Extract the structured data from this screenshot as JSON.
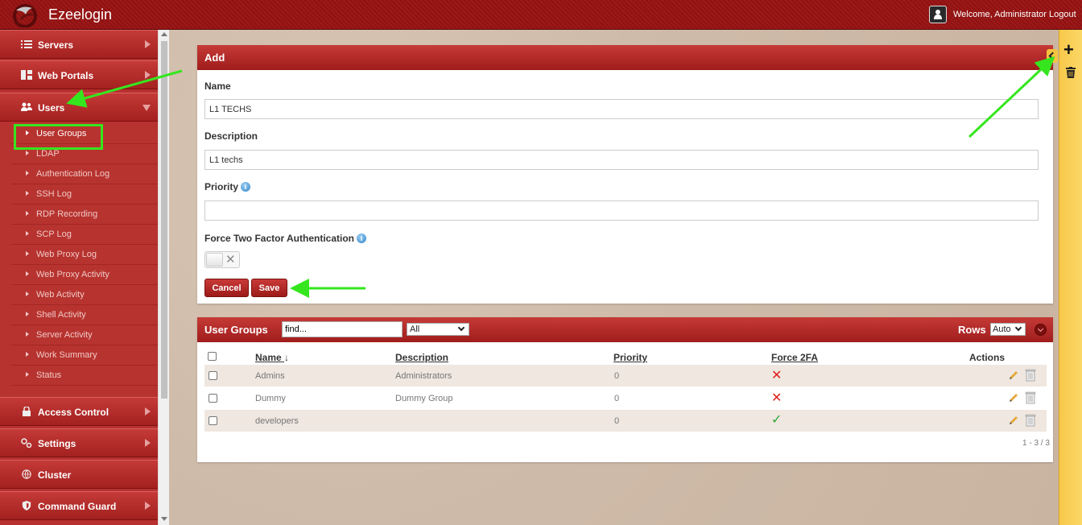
{
  "app": {
    "title": "Ezeelogin",
    "welcome": "Welcome, Administrator Logout"
  },
  "sidebar": {
    "menu": [
      {
        "label": "Servers",
        "icon": "list-icon"
      },
      {
        "label": "Web Portals",
        "icon": "dashboard-icon"
      },
      {
        "label": "Users",
        "icon": "users-icon",
        "expanded": true
      },
      {
        "label": "Access Control",
        "icon": "lock-icon"
      },
      {
        "label": "Settings",
        "icon": "gears-icon"
      },
      {
        "label": "Cluster",
        "icon": "globe-icon"
      },
      {
        "label": "Command Guard",
        "icon": "shield-icon"
      }
    ],
    "submenu": [
      {
        "label": "User Groups",
        "active": true
      },
      {
        "label": "LDAP"
      },
      {
        "label": "Authentication Log"
      },
      {
        "label": "SSH Log"
      },
      {
        "label": "RDP Recording"
      },
      {
        "label": "SCP Log"
      },
      {
        "label": "Web Proxy Log"
      },
      {
        "label": "Web Proxy Activity"
      },
      {
        "label": "Web Activity"
      },
      {
        "label": "Shell Activity"
      },
      {
        "label": "Server Activity"
      },
      {
        "label": "Work Summary"
      },
      {
        "label": "Status"
      }
    ]
  },
  "form": {
    "title": "Add",
    "name_label": "Name",
    "name_value": "L1 TECHS",
    "description_label": "Description",
    "description_value": "L1 techs",
    "priority_label": "Priority",
    "priority_value": "",
    "force2fa_label": "Force Two Factor Authentication",
    "force2fa_on": false,
    "cancel_label": "Cancel",
    "save_label": "Save"
  },
  "list": {
    "title": "User Groups",
    "search_value": "find...",
    "filter_value": "All",
    "rows_label": "Rows",
    "rows_value": "Auto",
    "columns": [
      "Name",
      "Description",
      "Priority",
      "Force 2FA",
      "Actions"
    ],
    "rows": [
      {
        "name": "Admins",
        "description": "Administrators",
        "priority": "0",
        "force2fa": false
      },
      {
        "name": "Dummy",
        "description": "Dummy Group",
        "priority": "0",
        "force2fa": false
      },
      {
        "name": "developers",
        "description": "",
        "priority": "0",
        "force2fa": true
      }
    ],
    "pager": "1 - 3 / 3"
  },
  "colors": {
    "header_red": "#a01d1c",
    "accent_yellow": "#f7c84a",
    "annotation_green": "#35e61e"
  }
}
